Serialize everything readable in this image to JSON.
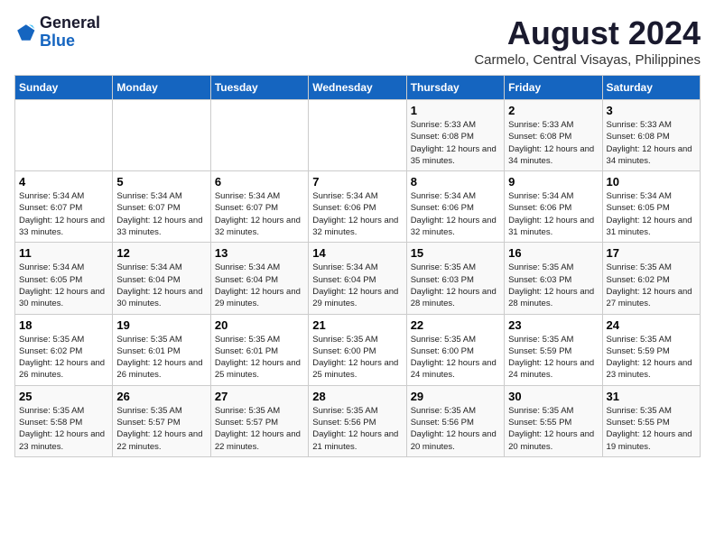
{
  "header": {
    "logo_line1": "General",
    "logo_line2": "Blue",
    "month_year": "August 2024",
    "location": "Carmelo, Central Visayas, Philippines"
  },
  "days_of_week": [
    "Sunday",
    "Monday",
    "Tuesday",
    "Wednesday",
    "Thursday",
    "Friday",
    "Saturday"
  ],
  "weeks": [
    [
      {
        "day": "",
        "text": ""
      },
      {
        "day": "",
        "text": ""
      },
      {
        "day": "",
        "text": ""
      },
      {
        "day": "",
        "text": ""
      },
      {
        "day": "1",
        "text": "Sunrise: 5:33 AM\nSunset: 6:08 PM\nDaylight: 12 hours and 35 minutes."
      },
      {
        "day": "2",
        "text": "Sunrise: 5:33 AM\nSunset: 6:08 PM\nDaylight: 12 hours and 34 minutes."
      },
      {
        "day": "3",
        "text": "Sunrise: 5:33 AM\nSunset: 6:08 PM\nDaylight: 12 hours and 34 minutes."
      }
    ],
    [
      {
        "day": "4",
        "text": "Sunrise: 5:34 AM\nSunset: 6:07 PM\nDaylight: 12 hours and 33 minutes."
      },
      {
        "day": "5",
        "text": "Sunrise: 5:34 AM\nSunset: 6:07 PM\nDaylight: 12 hours and 33 minutes."
      },
      {
        "day": "6",
        "text": "Sunrise: 5:34 AM\nSunset: 6:07 PM\nDaylight: 12 hours and 32 minutes."
      },
      {
        "day": "7",
        "text": "Sunrise: 5:34 AM\nSunset: 6:06 PM\nDaylight: 12 hours and 32 minutes."
      },
      {
        "day": "8",
        "text": "Sunrise: 5:34 AM\nSunset: 6:06 PM\nDaylight: 12 hours and 32 minutes."
      },
      {
        "day": "9",
        "text": "Sunrise: 5:34 AM\nSunset: 6:06 PM\nDaylight: 12 hours and 31 minutes."
      },
      {
        "day": "10",
        "text": "Sunrise: 5:34 AM\nSunset: 6:05 PM\nDaylight: 12 hours and 31 minutes."
      }
    ],
    [
      {
        "day": "11",
        "text": "Sunrise: 5:34 AM\nSunset: 6:05 PM\nDaylight: 12 hours and 30 minutes."
      },
      {
        "day": "12",
        "text": "Sunrise: 5:34 AM\nSunset: 6:04 PM\nDaylight: 12 hours and 30 minutes."
      },
      {
        "day": "13",
        "text": "Sunrise: 5:34 AM\nSunset: 6:04 PM\nDaylight: 12 hours and 29 minutes."
      },
      {
        "day": "14",
        "text": "Sunrise: 5:34 AM\nSunset: 6:04 PM\nDaylight: 12 hours and 29 minutes."
      },
      {
        "day": "15",
        "text": "Sunrise: 5:35 AM\nSunset: 6:03 PM\nDaylight: 12 hours and 28 minutes."
      },
      {
        "day": "16",
        "text": "Sunrise: 5:35 AM\nSunset: 6:03 PM\nDaylight: 12 hours and 28 minutes."
      },
      {
        "day": "17",
        "text": "Sunrise: 5:35 AM\nSunset: 6:02 PM\nDaylight: 12 hours and 27 minutes."
      }
    ],
    [
      {
        "day": "18",
        "text": "Sunrise: 5:35 AM\nSunset: 6:02 PM\nDaylight: 12 hours and 26 minutes."
      },
      {
        "day": "19",
        "text": "Sunrise: 5:35 AM\nSunset: 6:01 PM\nDaylight: 12 hours and 26 minutes."
      },
      {
        "day": "20",
        "text": "Sunrise: 5:35 AM\nSunset: 6:01 PM\nDaylight: 12 hours and 25 minutes."
      },
      {
        "day": "21",
        "text": "Sunrise: 5:35 AM\nSunset: 6:00 PM\nDaylight: 12 hours and 25 minutes."
      },
      {
        "day": "22",
        "text": "Sunrise: 5:35 AM\nSunset: 6:00 PM\nDaylight: 12 hours and 24 minutes."
      },
      {
        "day": "23",
        "text": "Sunrise: 5:35 AM\nSunset: 5:59 PM\nDaylight: 12 hours and 24 minutes."
      },
      {
        "day": "24",
        "text": "Sunrise: 5:35 AM\nSunset: 5:59 PM\nDaylight: 12 hours and 23 minutes."
      }
    ],
    [
      {
        "day": "25",
        "text": "Sunrise: 5:35 AM\nSunset: 5:58 PM\nDaylight: 12 hours and 23 minutes."
      },
      {
        "day": "26",
        "text": "Sunrise: 5:35 AM\nSunset: 5:57 PM\nDaylight: 12 hours and 22 minutes."
      },
      {
        "day": "27",
        "text": "Sunrise: 5:35 AM\nSunset: 5:57 PM\nDaylight: 12 hours and 22 minutes."
      },
      {
        "day": "28",
        "text": "Sunrise: 5:35 AM\nSunset: 5:56 PM\nDaylight: 12 hours and 21 minutes."
      },
      {
        "day": "29",
        "text": "Sunrise: 5:35 AM\nSunset: 5:56 PM\nDaylight: 12 hours and 20 minutes."
      },
      {
        "day": "30",
        "text": "Sunrise: 5:35 AM\nSunset: 5:55 PM\nDaylight: 12 hours and 20 minutes."
      },
      {
        "day": "31",
        "text": "Sunrise: 5:35 AM\nSunset: 5:55 PM\nDaylight: 12 hours and 19 minutes."
      }
    ]
  ]
}
